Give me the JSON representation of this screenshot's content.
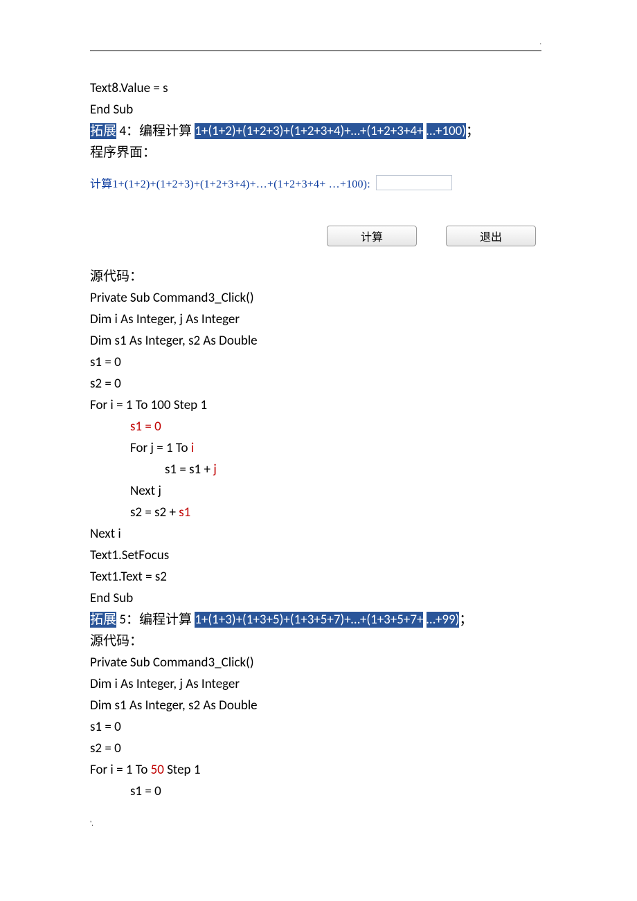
{
  "code_top": {
    "l1": "Text8.Value = s",
    "l2": "End Sub"
  },
  "section4": {
    "hl_prefix": "拓展",
    "hl_num": "4：编程计算",
    "hl_expr": "1+(1+2)+(1+2+3)+(1+2+3+4)+…+(1+2+3+4+",
    "hl_tail": "…+100)",
    "suffix": "；",
    "ui_title": "程序界面：",
    "ui_label": "计算1+(1+2)+(1+2+3)+(1+2+3+4)+…+(1+2+3+4+ …+100):",
    "btn_calc": "计算",
    "btn_exit": "退出",
    "src_title": "源代码：",
    "code": {
      "l1": "Private Sub Command3_Click()",
      "l2": "Dim i As Integer, j As Integer",
      "l3": "Dim s1 As Integer, s2 As Double",
      "l4": "s1 = 0",
      "l5": "s2 = 0",
      "l6": "For i = 1 To 100 Step 1",
      "l7": "s1 = 0",
      "l8a": "For j = 1 To ",
      "l8b": "i",
      "l9a": "s1 = s1 + ",
      "l9b": "j",
      "l10": "Next j",
      "l11a": "s2 = s2 + ",
      "l11b": "s1",
      "l12": "Next i",
      "l13": "Text1.SetFocus",
      "l14": "Text1.Text = s2",
      "l15": "End Sub"
    }
  },
  "section5": {
    "hl_prefix": "拓展",
    "hl_num": "5：编程计算",
    "hl_expr": "1+(1+3)+(1+3+5)+(1+3+5+7)+…+(1+3+5+7+",
    "hl_tail": "…+99)",
    "suffix": "；",
    "src_title": "源代码：",
    "code": {
      "l1": "Private Sub Command3_Click()",
      "l2": "Dim i As Integer, j As Integer",
      "l3": "Dim s1 As Integer, s2 As Double",
      "l4": "s1 = 0",
      "l5": "s2 = 0",
      "l6a": "For i = 1 To ",
      "l6b": "50",
      "l6c": " Step 1",
      "l7": "s1 = 0"
    }
  }
}
